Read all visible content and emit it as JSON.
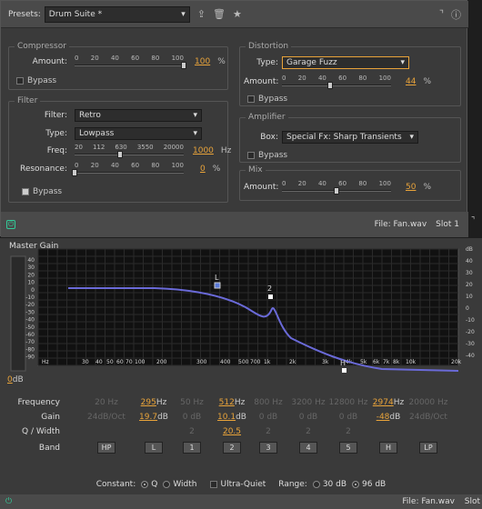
{
  "top": {
    "presets_label": "Presets:",
    "preset_value": "Drum Suite *"
  },
  "compressor": {
    "title": "Compressor",
    "amount_label": "Amount:",
    "ticks": [
      "0",
      "20",
      "40",
      "60",
      "80",
      "100"
    ],
    "amount_value": "100",
    "unit": "%",
    "bypass": "Bypass",
    "level": 1.0
  },
  "filter": {
    "title": "Filter",
    "filter_label": "Filter:",
    "filter_value": "Retro",
    "type_label": "Type:",
    "type_value": "Lowpass",
    "freq_label": "Freq:",
    "freq_ticks": [
      "20",
      "112",
      "630",
      "3550",
      "20000"
    ],
    "freq_value": "1000",
    "freq_unit": "Hz",
    "res_label": "Resonance:",
    "res_ticks": [
      "0",
      "20",
      "40",
      "60",
      "80",
      "100"
    ],
    "res_value": "0",
    "res_unit": "%",
    "bypass": "Bypass",
    "freq_level": 0.42,
    "res_level": 0.0
  },
  "distortion": {
    "title": "Distortion",
    "type_label": "Type:",
    "type_value": "Garage Fuzz",
    "amount_label": "Amount:",
    "ticks": [
      "0",
      "20",
      "40",
      "60",
      "80",
      "100"
    ],
    "amount_value": "44",
    "unit": "%",
    "bypass": "Bypass",
    "level": 0.44
  },
  "amplifier": {
    "title": "Amplifier",
    "box_label": "Box:",
    "box_value": "Special Fx: Sharp Transients",
    "bypass": "Bypass"
  },
  "mix": {
    "title": "Mix",
    "amount_label": "Amount:",
    "ticks": [
      "0",
      "20",
      "40",
      "60",
      "80",
      "100"
    ],
    "amount_value": "50",
    "unit": "%",
    "level": 0.5
  },
  "status1": {
    "file": "File: Fan.wav",
    "slot": "Slot 1"
  },
  "eq": {
    "master_gain": "Master Gain",
    "db_left": [
      "40",
      "30",
      "20",
      "10",
      "0",
      "-10",
      "-20",
      "-30",
      "-40",
      "-50",
      "-60",
      "-70",
      "-80",
      "-90"
    ],
    "db_right": [
      "dB",
      "40",
      "30",
      "20",
      "10",
      "0",
      "-10",
      "-20",
      "-30",
      "-40"
    ],
    "hz": [
      "Hz",
      "30",
      "40",
      "50",
      "60",
      "70",
      "100",
      "200",
      "300",
      "400",
      "500",
      "700",
      "1k",
      "2k",
      "3k",
      "4k",
      "5k",
      "6k",
      "7k",
      "8k",
      "10k",
      "20k"
    ],
    "gain_value": "0",
    "gain_unit": "dB",
    "node_labels": [
      "L",
      "2",
      "H"
    ]
  },
  "bands": {
    "row_labels": {
      "frequency": "Frequency",
      "gain": "Gain",
      "q": "Q / Width",
      "band": "Band"
    },
    "freq": [
      {
        "v": "20 Hz",
        "on": false
      },
      {
        "v": "295",
        "u": "Hz",
        "on": true
      },
      {
        "v": "50 Hz",
        "on": false
      },
      {
        "v": "512",
        "u": "Hz",
        "on": true
      },
      {
        "v": "800 Hz",
        "on": false
      },
      {
        "v": "3200 Hz",
        "on": false
      },
      {
        "v": "12800 Hz",
        "on": false
      },
      {
        "v": "2974",
        "u": "Hz",
        "on": true
      },
      {
        "v": "20000 Hz",
        "on": false
      }
    ],
    "gain": [
      {
        "v": "24dB/Oct",
        "on": false
      },
      {
        "v": "19.7",
        "u": "dB",
        "on": true
      },
      {
        "v": "0 dB",
        "on": false
      },
      {
        "v": "10.1",
        "u": "dB",
        "on": true
      },
      {
        "v": "0 dB",
        "on": false
      },
      {
        "v": "0 dB",
        "on": false
      },
      {
        "v": "0 dB",
        "on": false
      },
      {
        "v": "-48",
        "u": "dB",
        "on": true
      },
      {
        "v": "24dB/Oct",
        "on": false
      }
    ],
    "q": [
      {
        "v": "",
        "on": false
      },
      {
        "v": "",
        "on": false
      },
      {
        "v": "2",
        "on": false
      },
      {
        "v": "20.5",
        "on": true
      },
      {
        "v": "2",
        "on": false
      },
      {
        "v": "2",
        "on": false
      },
      {
        "v": "2",
        "on": false
      },
      {
        "v": "",
        "on": false
      },
      {
        "v": "",
        "on": false
      }
    ],
    "band": [
      "HP",
      "L",
      "1",
      "2",
      "3",
      "4",
      "5",
      "H",
      "LP"
    ]
  },
  "footer": {
    "constant": "Constant:",
    "q": "Q",
    "width": "Width",
    "ultra": "Ultra-Quiet",
    "range": "Range:",
    "r30": "30 dB",
    "r96": "96 dB"
  },
  "status2": {
    "file": "File: Fan.wav",
    "slot": "Slot"
  },
  "colors": {
    "accent": "#e8a33a",
    "curve": "#6a6ad8",
    "power": "#33cc99"
  }
}
